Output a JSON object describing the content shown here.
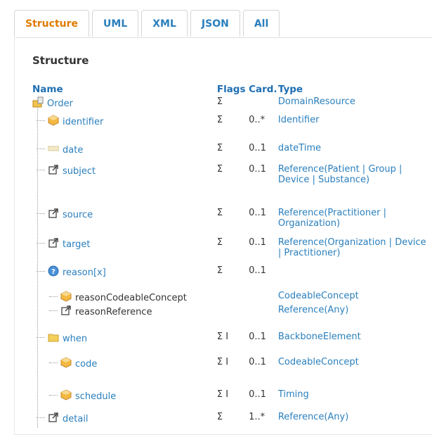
{
  "tabs": [
    "Structure",
    "UML",
    "XML",
    "JSON",
    "All"
  ],
  "heading": "Structure",
  "columns": {
    "name": "Name",
    "flags": "Flags",
    "card": "Card.",
    "type": "Type"
  },
  "rows": [
    {
      "name": "Order",
      "flags": "Σ",
      "card": "",
      "type": "DomainResource",
      "icon": "resource-icon"
    },
    {
      "name": "identifier",
      "flags": "Σ",
      "card": "0..*",
      "type": "Identifier",
      "icon": "datatype-icon"
    },
    {
      "name": "date",
      "flags": "Σ",
      "card": "0..1",
      "type": "dateTime",
      "icon": "primitive-icon"
    },
    {
      "name": "subject",
      "flags": "Σ",
      "card": "0..1",
      "type_parts": [
        "Reference(",
        "Patient",
        " | ",
        "Group",
        " | ",
        "Device",
        " | ",
        "Substance",
        ")"
      ],
      "icon": "reference-icon"
    },
    {
      "name": "source",
      "flags": "Σ",
      "card": "0..1",
      "type_parts": [
        "Reference(",
        "Practitioner",
        " | ",
        "Organization",
        ")"
      ],
      "icon": "reference-icon"
    },
    {
      "name": "target",
      "flags": "Σ",
      "card": "0..1",
      "type_parts": [
        "Reference(",
        "Organization",
        " | ",
        "Device",
        " | ",
        "Practitioner",
        ")"
      ],
      "icon": "reference-icon"
    },
    {
      "name": "reason[x]",
      "flags": "Σ",
      "card": "0..1",
      "type": "",
      "icon": "choice-icon"
    },
    {
      "name": "reasonCodeableConcept",
      "flags": "",
      "card": "",
      "type": "CodeableConcept",
      "icon": "datatype-icon"
    },
    {
      "name": "reasonReference",
      "flags": "",
      "card": "",
      "type": "Reference(Any)",
      "icon": "reference-icon"
    },
    {
      "name": "when",
      "flags": "Σ I",
      "card": "0..1",
      "type": "BackboneElement",
      "icon": "folder-icon"
    },
    {
      "name": "code",
      "flags": "Σ I",
      "card": "0..1",
      "type": "CodeableConcept",
      "icon": "datatype-icon"
    },
    {
      "name": "schedule",
      "flags": "Σ I",
      "card": "0..1",
      "type": "Timing",
      "icon": "datatype-icon"
    },
    {
      "name": "detail",
      "flags": "Σ",
      "card": "1..*",
      "type": "Reference(Any)",
      "icon": "reference-icon"
    }
  ],
  "colors": {
    "link": "#2a7fbd",
    "active_tab": "#e07b00",
    "header": "#1f6fb3"
  }
}
